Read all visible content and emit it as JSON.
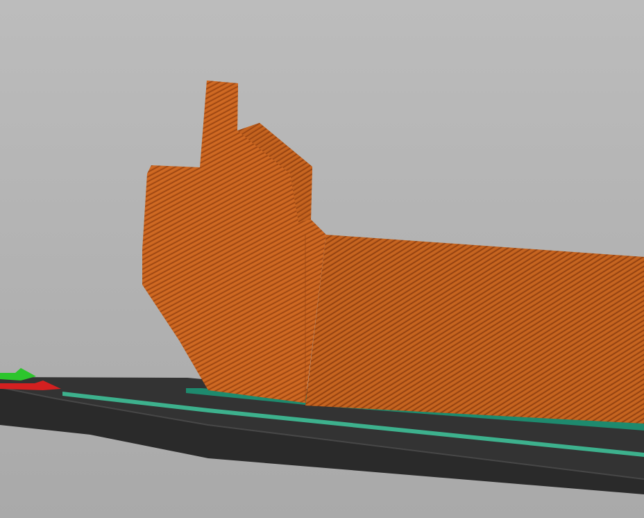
{
  "viewport": {
    "background_top": "#bcbcbc",
    "background_bottom": "#a9a9a9"
  },
  "model": {
    "fill": "#c9641f",
    "stripe_color": "#9a4512",
    "stripe_highlight": "#e07a30"
  },
  "build_plate": {
    "surface_color": "#333333",
    "side_color": "#2a2a2a",
    "edge_color": "#474747"
  },
  "raft": {
    "color": "#1e8a6e",
    "highlight": "#3fc89e"
  },
  "gizmo": {
    "x_axis_color": "#d32020",
    "y_axis_color": "#2cc52c"
  }
}
